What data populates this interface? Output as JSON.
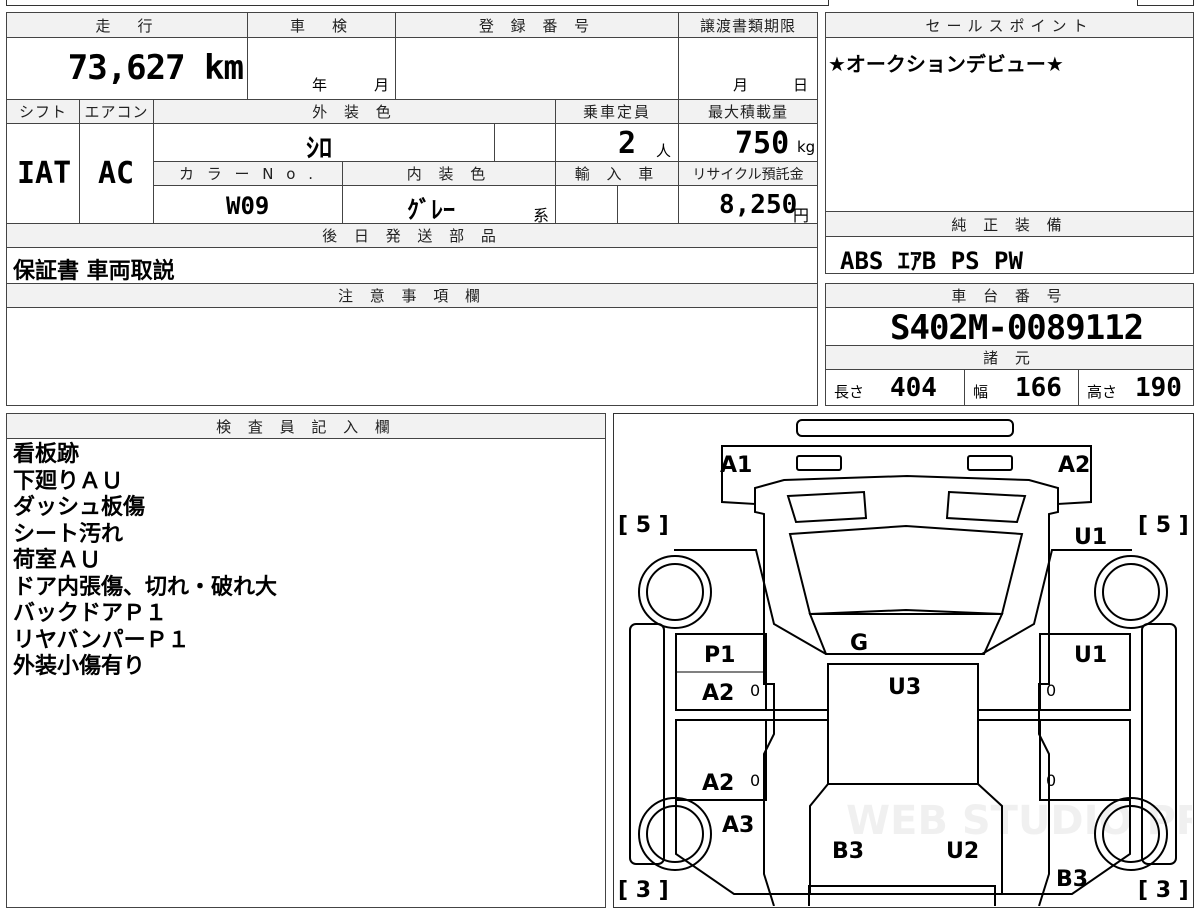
{
  "header": {
    "mileage": {
      "label": "走　行",
      "value": "73,627 km"
    },
    "shaken": {
      "label": "車　検",
      "year_unit": "年",
      "month_unit": "月"
    },
    "registration": {
      "label": "登 録 番 号",
      "value": ""
    },
    "transfer_deadline": {
      "label": "譲渡書類期限",
      "month_unit": "月",
      "day_unit": "日"
    },
    "shift": {
      "label": "シフト",
      "value": "IAT"
    },
    "aircon": {
      "label": "エアコン",
      "value": "AC"
    },
    "exterior_color": {
      "label": "外 装 色",
      "value": "ｼﾛ"
    },
    "seating": {
      "label": "乗車定員",
      "value": "2",
      "unit": "人"
    },
    "max_load": {
      "label": "最大積載量",
      "value": "750",
      "unit": "kg"
    },
    "color_no": {
      "label": "カ ラ ー N o .",
      "value": "W09"
    },
    "interior_color": {
      "label": "内 装 色",
      "value": "ｸﾞﾚｰ",
      "suffix": "系"
    },
    "import": {
      "label": "輸 入 車"
    },
    "recycle_fee": {
      "label": "リサイクル預託金",
      "value": "8,250",
      "unit": "円"
    },
    "later_parts": {
      "label": "後 日 発 送 部 品",
      "value": "保証書 車両取説"
    }
  },
  "sales_points": {
    "label": "セールスポイント",
    "value": "★オークションデビュー★"
  },
  "equipment": {
    "label": "純 正 装 備",
    "value": "ABS ｴｱB PS PW"
  },
  "caution": {
    "label": "注 意 事 項 欄"
  },
  "chassis": {
    "label": "車 台 番 号",
    "value": "S402M-0089112"
  },
  "specs": {
    "label": "諸 元",
    "length_label": "長さ",
    "length": "404",
    "width_label": "幅",
    "width": "166",
    "height_label": "高さ",
    "height": "190"
  },
  "inspector": {
    "label": "検 査 員 記 入 欄",
    "notes": [
      "看板跡",
      "下廻りＡＵ",
      "ダッシュ板傷",
      "シート汚れ",
      "荷室ＡＵ",
      "ドア内張傷、切れ・破れ大",
      "バックドアＰ１",
      "リヤバンパーＰ１",
      "外装小傷有り"
    ]
  },
  "diagram": {
    "tire_front_left": "[ 5 ]",
    "tire_front_right": "[ 5 ]",
    "tire_rear_left": "[ 3 ]",
    "tire_rear_right": "[ 3 ]",
    "marks": {
      "a1": "A1",
      "a2_top": "A2",
      "u1_top": "U1",
      "g": "G",
      "p1": "P1",
      "a2_left_1": "A2",
      "u3": "U3",
      "u1_right": "U1",
      "a2_left_2": "A2",
      "a3": "A3",
      "b3_bottom": "B3",
      "u2": "U2",
      "b3_right": "B3",
      "zero": "0"
    },
    "watermark": "WEB STUDIO PRO"
  }
}
